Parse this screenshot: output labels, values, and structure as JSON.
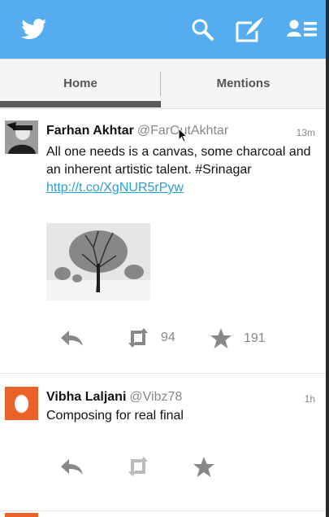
{
  "header": {
    "logo_icon": "twitter-bird-icon",
    "search_icon": "search-icon",
    "compose_icon": "compose-icon",
    "profile_icon": "profile-icon",
    "bar_color": "#55acee"
  },
  "tabs": [
    {
      "label": "Home",
      "active": true
    },
    {
      "label": "Mentions",
      "active": false
    }
  ],
  "tweets": [
    {
      "name": "Farhan Akhtar",
      "handle": "@FarOutAkhtar",
      "time": "13m",
      "text": "All one needs is a canvas, some charcoal and an inherent artistic talent. #Srinagar",
      "link": "http://t.co/XgNUR5rPyw",
      "retweets": "94",
      "favorites": "191"
    },
    {
      "name": "Vibha Laljani",
      "handle": "@Vibz78",
      "time": "1h",
      "text": "Composing for real final",
      "retweets": "",
      "favorites": ""
    }
  ],
  "colors": {
    "accent": "#55acee",
    "link": "#2a9fd6",
    "avatar_orange": "#e8622a"
  }
}
